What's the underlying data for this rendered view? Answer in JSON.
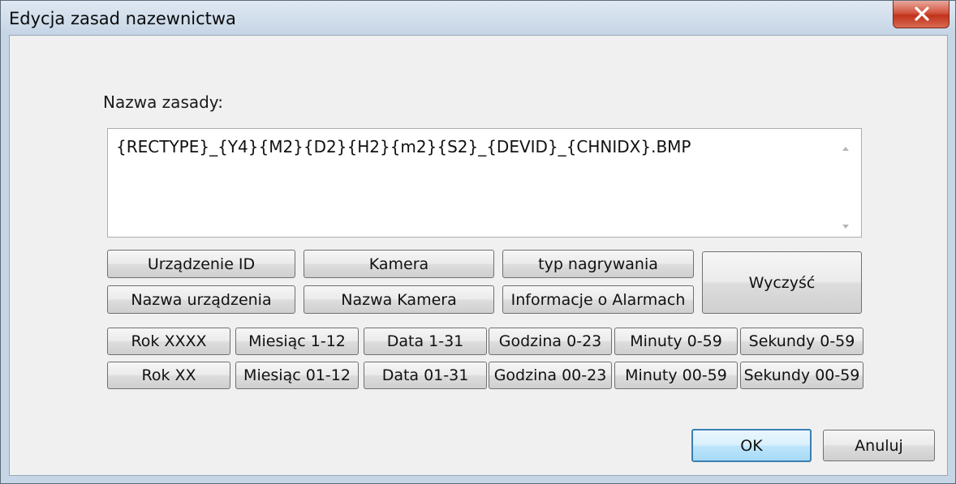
{
  "window": {
    "title": "Edycja zasad nazewnictwa"
  },
  "form": {
    "name_label": "Nazwa zasady:",
    "name_value": "{RECTYPE}_{Y4}{M2}{D2}{H2}{m2}{S2}_{DEVID}_{CHNIDX}.BMP"
  },
  "insert_buttons": {
    "device_id": "Urządzenie ID",
    "camera": "Kamera",
    "record_type": "typ nagrywania",
    "device_name": "Nazwa urządzenia",
    "camera_name": "Nazwa Kamera",
    "alarm_info": "Informacje o Alarmach",
    "clear": "Wyczyść"
  },
  "date_buttons": {
    "row1": [
      "Rok XXXX",
      "Miesiąc 1-12",
      "Data 1-31",
      "Godzina 0-23",
      "Minuty 0-59",
      "Sekundy 0-59"
    ],
    "row2": [
      "Rok XX",
      "Miesiąc 01-12",
      "Data 01-31",
      "Godzina 00-23",
      "Minuty 00-59",
      "Sekundy 00-59"
    ]
  },
  "footer": {
    "ok": "OK",
    "cancel": "Anuluj"
  },
  "icons": {
    "close": "close-icon",
    "scroll_up": "scroll-up-arrow-icon",
    "scroll_down": "scroll-down-arrow-icon"
  },
  "colors": {
    "close_button": "#c8381f",
    "default_button_border": "#3c7fb1",
    "dialog_background": "#f0f0f0"
  }
}
